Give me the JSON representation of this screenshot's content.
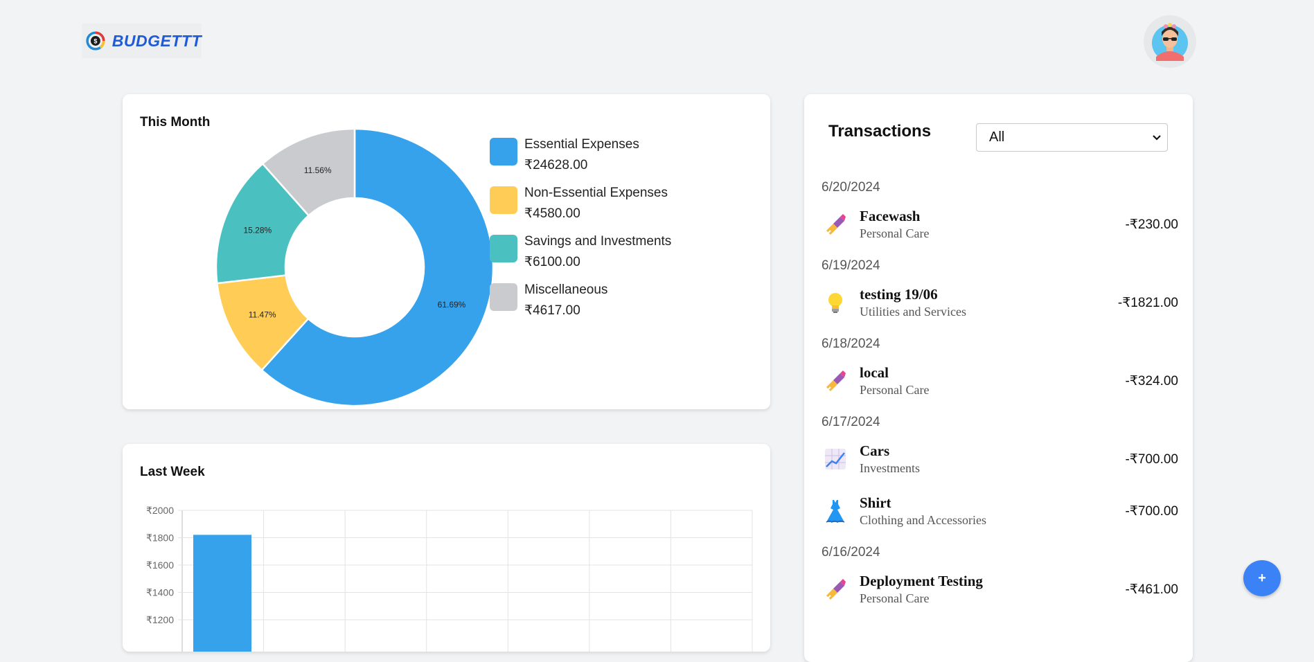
{
  "header": {
    "app_name": "BUDGETTT"
  },
  "this_month": {
    "title": "This Month",
    "legend": [
      {
        "label": "Essential Expenses",
        "amount": "₹24628.00",
        "color": "#36a2eb"
      },
      {
        "label": "Non-Essential Expenses",
        "amount": "₹4580.00",
        "color": "#ffcd56"
      },
      {
        "label": "Savings and Investments",
        "amount": "₹6100.00",
        "color": "#4bc0c0"
      },
      {
        "label": "Miscellaneous",
        "amount": "₹4617.00",
        "color": "#c9cbcf"
      }
    ]
  },
  "last_week": {
    "title": "Last Week"
  },
  "chart_data": [
    {
      "type": "pie",
      "title": "This Month",
      "categories": [
        "Essential Expenses",
        "Non-Essential Expenses",
        "Savings and Investments",
        "Miscellaneous"
      ],
      "values": [
        61.69,
        11.47,
        15.28,
        11.56
      ],
      "data_labels": [
        "61.69%",
        "11.47%",
        "15.28%",
        "11.56%"
      ],
      "colors": [
        "#36a2eb",
        "#ffcd56",
        "#4bc0c0",
        "#c9cbcf"
      ]
    },
    {
      "type": "bar",
      "title": "Last Week",
      "y_ticks": [
        "₹2000",
        "₹1800",
        "₹1600",
        "₹1400",
        "₹1200"
      ],
      "values": [
        1821
      ],
      "ylim": [
        1200,
        2000
      ],
      "grid": true,
      "color": "#36a2eb"
    }
  ],
  "transactions": {
    "title": "Transactions",
    "filter_value": "All",
    "groups": [
      {
        "date": "6/20/2024",
        "items": [
          {
            "name": "Facewash",
            "category": "Personal Care",
            "amount": "-₹230.00",
            "icon": "lipstick-icon"
          }
        ]
      },
      {
        "date": "6/19/2024",
        "items": [
          {
            "name": "testing 19/06",
            "category": "Utilities and Services",
            "amount": "-₹1821.00",
            "icon": "lightbulb-icon"
          }
        ]
      },
      {
        "date": "6/18/2024",
        "items": [
          {
            "name": "local",
            "category": "Personal Care",
            "amount": "-₹324.00",
            "icon": "lipstick-icon"
          }
        ]
      },
      {
        "date": "6/17/2024",
        "items": [
          {
            "name": "Cars",
            "category": "Investments",
            "amount": "-₹700.00",
            "icon": "chart-increasing-icon"
          },
          {
            "name": "Shirt",
            "category": "Clothing and Accessories",
            "amount": "-₹700.00",
            "icon": "dress-icon"
          }
        ]
      },
      {
        "date": "6/16/2024",
        "items": [
          {
            "name": "Deployment Testing",
            "category": "Personal Care",
            "amount": "-₹461.00",
            "icon": "lipstick-icon"
          }
        ]
      }
    ]
  },
  "fab": {
    "label": "+"
  }
}
